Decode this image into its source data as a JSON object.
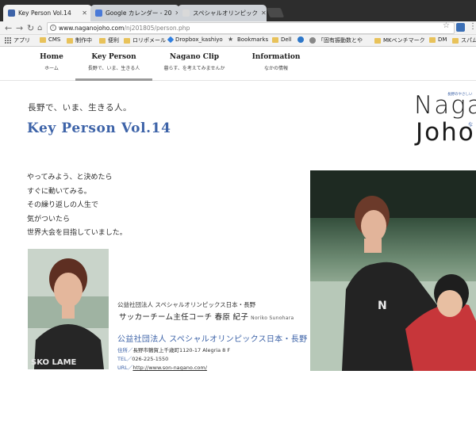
{
  "browser": {
    "tabs": [
      {
        "title": "Key Person Vol.14",
        "favicon_color": "#3d63a8",
        "active": true
      },
      {
        "title": "Google カレンダー - 20",
        "favicon_color": "#4a7ad8",
        "active": false
      },
      {
        "title": "スペシャルオリンピック",
        "favicon_color": "#d9d9d9",
        "active": false
      }
    ],
    "url": {
      "host": "www.naganojoho.com",
      "path": "/nj201805/person.php"
    },
    "bookmarks": [
      {
        "label": "アプリ",
        "icon": "apps-grid-icon"
      },
      {
        "label": "CMS",
        "icon": "folder-icon"
      },
      {
        "label": "制作中",
        "icon": "folder-icon"
      },
      {
        "label": "便利",
        "icon": "folder-icon"
      },
      {
        "label": "ロリポメール",
        "icon": "folder-icon"
      },
      {
        "label": "Dropbox_kashiyo",
        "icon": "dropbox-icon"
      },
      {
        "label": "Bookmarks",
        "icon": "star-icon"
      },
      {
        "label": "Dell",
        "icon": "folder-icon"
      },
      {
        "label": "",
        "icon": "site-icon"
      },
      {
        "label": "「固有振動数とや",
        "icon": "site-icon"
      },
      {
        "label": "MKベンチマーク",
        "icon": "folder-icon"
      },
      {
        "label": "DM",
        "icon": "folder-icon"
      },
      {
        "label": "スパム",
        "icon": "folder-icon"
      }
    ]
  },
  "nav": {
    "items": [
      {
        "en": "Home",
        "jp": "ホーム"
      },
      {
        "en": "Key Person",
        "jp": "長野で、いま、生きる人"
      },
      {
        "en": "Nagano Clip",
        "jp": "暮らす、を考えてみませんか"
      },
      {
        "en": "Information",
        "jp": "なかの情報"
      }
    ]
  },
  "header": {
    "subtitle": "長野で、いま、生きる人。",
    "title": "Key Person Vol.14"
  },
  "logo": {
    "line1": "Naga",
    "line2": "Joho",
    "tagline": "長野のやさしい",
    "small": "な"
  },
  "quote": [
    "やってみよう、と決めたら",
    "すぐに動いてみる。",
    "その繰り返しの人生で",
    "気がついたら",
    "世界大会を目指していました。"
  ],
  "profile": {
    "org_small": "公益社団法人 スペシャルオリンピックス日本・長野",
    "role": "サッカーチーム主任コーチ 春原 紀子",
    "romaji": "Noriko Sunohara",
    "org_blue": "公益社団法人 スペシャルオリンピックス日本・長野",
    "address_label": "住所／",
    "address": "長野市鶴賀上千歳町1120-17 Alegria 8 F",
    "tel_label": "TEL／",
    "tel": "026-225-1550",
    "url_label": "URL／",
    "url": "http://www.son-nagano.com/"
  }
}
